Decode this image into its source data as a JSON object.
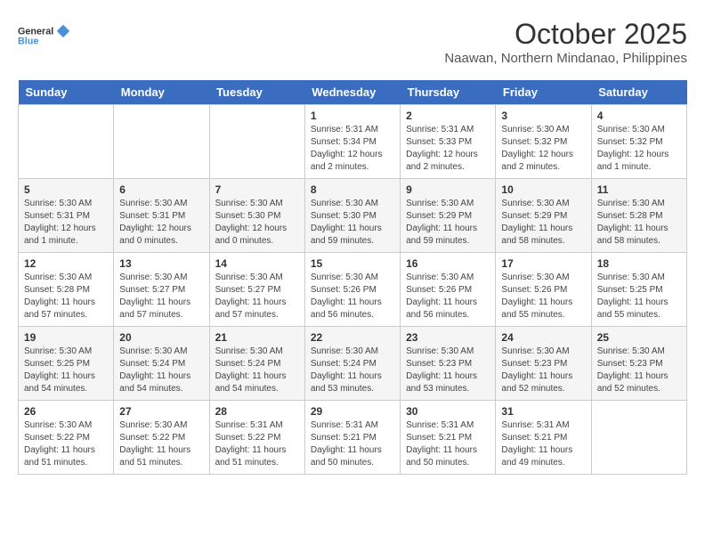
{
  "header": {
    "logo_line1": "General",
    "logo_line2": "Blue",
    "month": "October 2025",
    "location": "Naawan, Northern Mindanao, Philippines"
  },
  "weekdays": [
    "Sunday",
    "Monday",
    "Tuesday",
    "Wednesday",
    "Thursday",
    "Friday",
    "Saturday"
  ],
  "weeks": [
    [
      {
        "day": "",
        "info": ""
      },
      {
        "day": "",
        "info": ""
      },
      {
        "day": "",
        "info": ""
      },
      {
        "day": "1",
        "info": "Sunrise: 5:31 AM\nSunset: 5:34 PM\nDaylight: 12 hours\nand 2 minutes."
      },
      {
        "day": "2",
        "info": "Sunrise: 5:31 AM\nSunset: 5:33 PM\nDaylight: 12 hours\nand 2 minutes."
      },
      {
        "day": "3",
        "info": "Sunrise: 5:30 AM\nSunset: 5:32 PM\nDaylight: 12 hours\nand 2 minutes."
      },
      {
        "day": "4",
        "info": "Sunrise: 5:30 AM\nSunset: 5:32 PM\nDaylight: 12 hours\nand 1 minute."
      }
    ],
    [
      {
        "day": "5",
        "info": "Sunrise: 5:30 AM\nSunset: 5:31 PM\nDaylight: 12 hours\nand 1 minute."
      },
      {
        "day": "6",
        "info": "Sunrise: 5:30 AM\nSunset: 5:31 PM\nDaylight: 12 hours\nand 0 minutes."
      },
      {
        "day": "7",
        "info": "Sunrise: 5:30 AM\nSunset: 5:30 PM\nDaylight: 12 hours\nand 0 minutes."
      },
      {
        "day": "8",
        "info": "Sunrise: 5:30 AM\nSunset: 5:30 PM\nDaylight: 11 hours\nand 59 minutes."
      },
      {
        "day": "9",
        "info": "Sunrise: 5:30 AM\nSunset: 5:29 PM\nDaylight: 11 hours\nand 59 minutes."
      },
      {
        "day": "10",
        "info": "Sunrise: 5:30 AM\nSunset: 5:29 PM\nDaylight: 11 hours\nand 58 minutes."
      },
      {
        "day": "11",
        "info": "Sunrise: 5:30 AM\nSunset: 5:28 PM\nDaylight: 11 hours\nand 58 minutes."
      }
    ],
    [
      {
        "day": "12",
        "info": "Sunrise: 5:30 AM\nSunset: 5:28 PM\nDaylight: 11 hours\nand 57 minutes."
      },
      {
        "day": "13",
        "info": "Sunrise: 5:30 AM\nSunset: 5:27 PM\nDaylight: 11 hours\nand 57 minutes."
      },
      {
        "day": "14",
        "info": "Sunrise: 5:30 AM\nSunset: 5:27 PM\nDaylight: 11 hours\nand 57 minutes."
      },
      {
        "day": "15",
        "info": "Sunrise: 5:30 AM\nSunset: 5:26 PM\nDaylight: 11 hours\nand 56 minutes."
      },
      {
        "day": "16",
        "info": "Sunrise: 5:30 AM\nSunset: 5:26 PM\nDaylight: 11 hours\nand 56 minutes."
      },
      {
        "day": "17",
        "info": "Sunrise: 5:30 AM\nSunset: 5:26 PM\nDaylight: 11 hours\nand 55 minutes."
      },
      {
        "day": "18",
        "info": "Sunrise: 5:30 AM\nSunset: 5:25 PM\nDaylight: 11 hours\nand 55 minutes."
      }
    ],
    [
      {
        "day": "19",
        "info": "Sunrise: 5:30 AM\nSunset: 5:25 PM\nDaylight: 11 hours\nand 54 minutes."
      },
      {
        "day": "20",
        "info": "Sunrise: 5:30 AM\nSunset: 5:24 PM\nDaylight: 11 hours\nand 54 minutes."
      },
      {
        "day": "21",
        "info": "Sunrise: 5:30 AM\nSunset: 5:24 PM\nDaylight: 11 hours\nand 54 minutes."
      },
      {
        "day": "22",
        "info": "Sunrise: 5:30 AM\nSunset: 5:24 PM\nDaylight: 11 hours\nand 53 minutes."
      },
      {
        "day": "23",
        "info": "Sunrise: 5:30 AM\nSunset: 5:23 PM\nDaylight: 11 hours\nand 53 minutes."
      },
      {
        "day": "24",
        "info": "Sunrise: 5:30 AM\nSunset: 5:23 PM\nDaylight: 11 hours\nand 52 minutes."
      },
      {
        "day": "25",
        "info": "Sunrise: 5:30 AM\nSunset: 5:23 PM\nDaylight: 11 hours\nand 52 minutes."
      }
    ],
    [
      {
        "day": "26",
        "info": "Sunrise: 5:30 AM\nSunset: 5:22 PM\nDaylight: 11 hours\nand 51 minutes."
      },
      {
        "day": "27",
        "info": "Sunrise: 5:30 AM\nSunset: 5:22 PM\nDaylight: 11 hours\nand 51 minutes."
      },
      {
        "day": "28",
        "info": "Sunrise: 5:31 AM\nSunset: 5:22 PM\nDaylight: 11 hours\nand 51 minutes."
      },
      {
        "day": "29",
        "info": "Sunrise: 5:31 AM\nSunset: 5:21 PM\nDaylight: 11 hours\nand 50 minutes."
      },
      {
        "day": "30",
        "info": "Sunrise: 5:31 AM\nSunset: 5:21 PM\nDaylight: 11 hours\nand 50 minutes."
      },
      {
        "day": "31",
        "info": "Sunrise: 5:31 AM\nSunset: 5:21 PM\nDaylight: 11 hours\nand 49 minutes."
      },
      {
        "day": "",
        "info": ""
      }
    ]
  ]
}
